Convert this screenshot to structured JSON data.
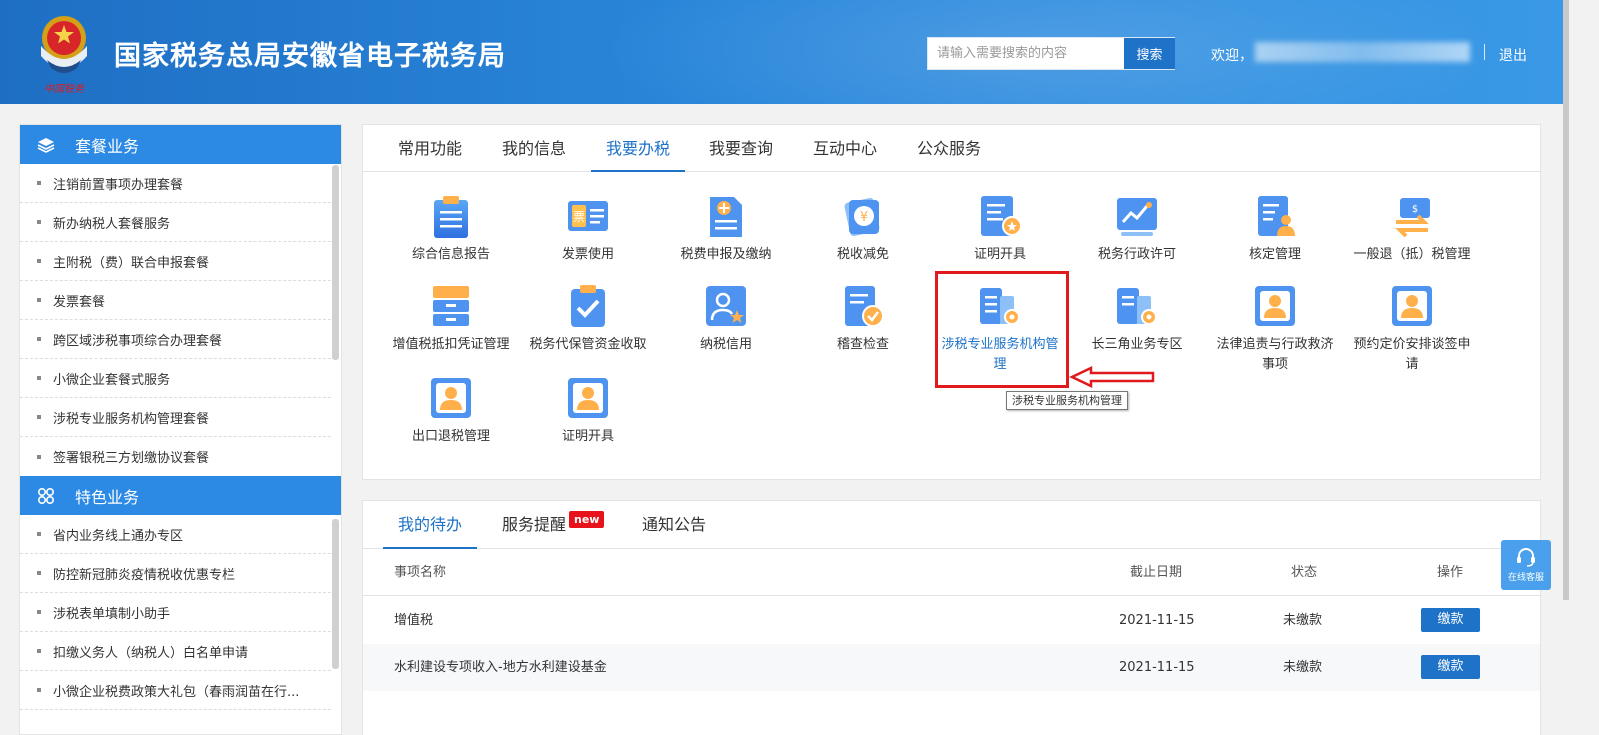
{
  "header": {
    "title": "国家税务总局安徽省电子税务局",
    "emblem_text": "中国税务",
    "search_placeholder": "请输入需要搜索的内容",
    "search_button": "搜索",
    "welcome": "欢迎，",
    "logout": "退出"
  },
  "sidebar": {
    "groups": [
      {
        "title": "套餐业务",
        "icon": "layers-icon",
        "items": [
          "注销前置事项办理套餐",
          "新办纳税人套餐服务",
          "主附税（费）联合申报套餐",
          "发票套餐",
          "跨区域涉税事项综合办理套餐",
          "小微企业套餐式服务",
          "涉税专业服务机构管理套餐",
          "签署银税三方划缴协议套餐"
        ]
      },
      {
        "title": "特色业务",
        "icon": "grid-icon",
        "items": [
          "省内业务线上通办专区",
          "防控新冠肺炎疫情税收优惠专栏",
          "涉税表单填制小助手",
          "扣缴义务人（纳税人）白名单申请",
          "小微企业税费政策大礼包（春雨润苗在行..."
        ]
      }
    ]
  },
  "main": {
    "tabs": [
      "常用功能",
      "我的信息",
      "我要办税",
      "我要查询",
      "互动中心",
      "公众服务"
    ],
    "active_tab": "我要办税",
    "functions": [
      {
        "label": "综合信息报告",
        "icon": "document-report-icon"
      },
      {
        "label": "发票使用",
        "icon": "invoice-icon"
      },
      {
        "label": "税费申报及缴纳",
        "icon": "declaration-icon"
      },
      {
        "label": "税收减免",
        "icon": "tax-reduction-icon"
      },
      {
        "label": "证明开具",
        "icon": "certificate-icon"
      },
      {
        "label": "税务行政许可",
        "icon": "license-chart-icon"
      },
      {
        "label": "核定管理",
        "icon": "assessment-icon"
      },
      {
        "label": "一般退（抵）税管理",
        "icon": "refund-icon"
      },
      {
        "label": "增值税抵扣凭证管理",
        "icon": "archive-icon"
      },
      {
        "label": "税务代保管资金收取",
        "icon": "clipboard-check-icon"
      },
      {
        "label": "纳税信用",
        "icon": "credit-user-icon"
      },
      {
        "label": "稽查检查",
        "icon": "inspection-icon"
      },
      {
        "label": "涉税专业服务机构管理",
        "icon": "agency-gear-icon"
      },
      {
        "label": "长三角业务专区",
        "icon": "region-gear-icon"
      },
      {
        "label": "法律追责与行政救济事项",
        "icon": "person-card-icon"
      },
      {
        "label": "预约定价安排谈签申请",
        "icon": "person-card-icon"
      },
      {
        "label": "出口退税管理",
        "icon": "person-card-icon"
      },
      {
        "label": "证明开具",
        "icon": "person-card-icon"
      }
    ],
    "tooltip": "涉税专业服务机构管理"
  },
  "todo": {
    "tabs": [
      "我的待办",
      "服务提醒",
      "通知公告"
    ],
    "badge": "new",
    "columns": [
      "事项名称",
      "截止日期",
      "状态",
      "操作"
    ],
    "rows": [
      {
        "name": "增值税",
        "date": "2021-11-15",
        "status": "未缴款",
        "action": "缴款"
      },
      {
        "name": "水利建设专项收入-地方水利建设基金",
        "date": "2021-11-15",
        "status": "未缴款",
        "action": "缴款"
      }
    ]
  },
  "float_service": {
    "label": "在线客服"
  },
  "colors": {
    "header_blue": "#2a86da",
    "accent_blue": "#1e72c8",
    "sidebar_head": "#2d8ae4",
    "badge_red": "#e8121a",
    "highlight_red": "#e0191d"
  }
}
